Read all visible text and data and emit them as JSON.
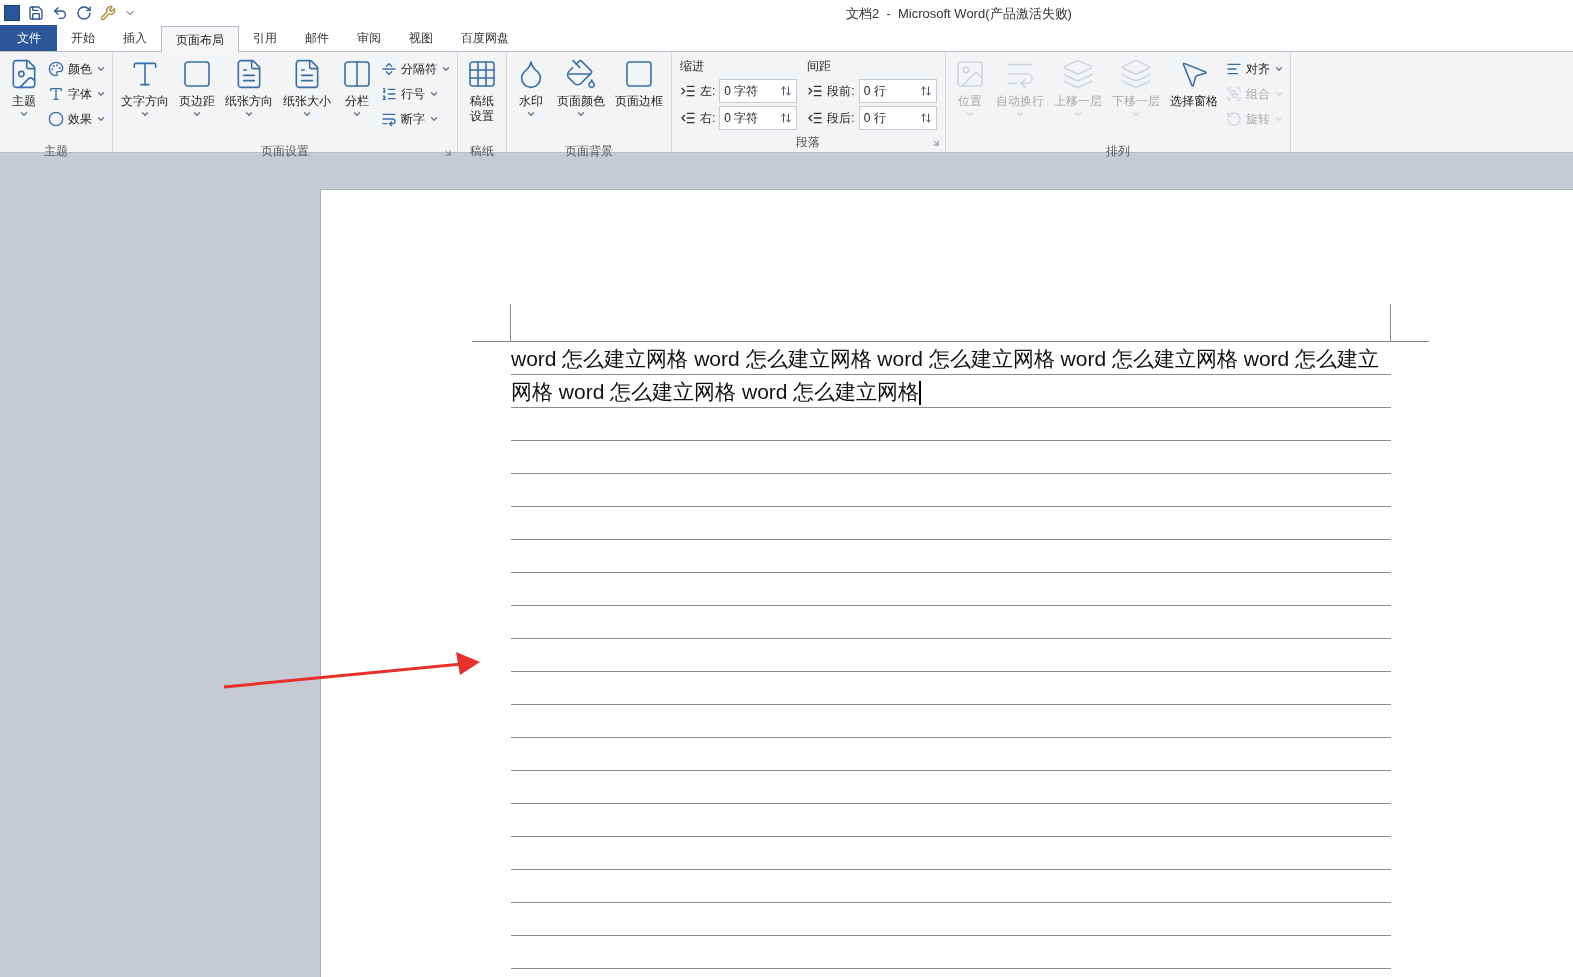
{
  "window": {
    "title": "文档2  -  Microsoft Word(产品激活失败)"
  },
  "tabs": [
    {
      "label": "文件",
      "kind": "file",
      "selected": false
    },
    {
      "label": "开始",
      "kind": "tab",
      "selected": false
    },
    {
      "label": "插入",
      "kind": "tab",
      "selected": false
    },
    {
      "label": "页面布局",
      "kind": "tab",
      "selected": true
    },
    {
      "label": "引用",
      "kind": "tab",
      "selected": false
    },
    {
      "label": "邮件",
      "kind": "tab",
      "selected": false
    },
    {
      "label": "审阅",
      "kind": "tab",
      "selected": false
    },
    {
      "label": "视图",
      "kind": "tab",
      "selected": false
    },
    {
      "label": "百度网盘",
      "kind": "tab",
      "selected": false
    }
  ],
  "ribbon": [
    {
      "name": "主题",
      "launcher": false,
      "columns": [
        {
          "kind": "large",
          "label": "主题",
          "dropdown": true,
          "disabled": false
        },
        {
          "kind": "stack",
          "items": [
            {
              "label": "颜色",
              "dropdown": true,
              "disabled": false
            },
            {
              "label": "字体",
              "dropdown": true,
              "disabled": false
            },
            {
              "label": "效果",
              "dropdown": true,
              "disabled": false
            }
          ]
        }
      ]
    },
    {
      "name": "页面设置",
      "launcher": true,
      "columns": [
        {
          "kind": "large",
          "label": "文字方向",
          "dropdown": true,
          "disabled": false
        },
        {
          "kind": "large",
          "label": "页边距",
          "dropdown": true,
          "disabled": false
        },
        {
          "kind": "large",
          "label": "纸张方向",
          "dropdown": true,
          "disabled": false
        },
        {
          "kind": "large",
          "label": "纸张大小",
          "dropdown": true,
          "disabled": false
        },
        {
          "kind": "large",
          "label": "分栏",
          "dropdown": true,
          "disabled": false
        },
        {
          "kind": "stack",
          "items": [
            {
              "label": "分隔符",
              "dropdown": true,
              "disabled": false
            },
            {
              "label": "行号",
              "dropdown": true,
              "disabled": false
            },
            {
              "label": "断字",
              "dropdown": true,
              "disabled": false
            }
          ]
        }
      ]
    },
    {
      "name": "稿纸",
      "launcher": false,
      "columns": [
        {
          "kind": "large",
          "label": "稿纸设置",
          "dropdown": false,
          "disabled": false
        }
      ]
    },
    {
      "name": "页面背景",
      "launcher": false,
      "columns": [
        {
          "kind": "large",
          "label": "水印",
          "dropdown": true,
          "disabled": false
        },
        {
          "kind": "large",
          "label": "页面颜色",
          "dropdown": true,
          "disabled": false
        },
        {
          "kind": "large",
          "label": "页面边框",
          "dropdown": false,
          "disabled": false
        }
      ]
    },
    {
      "name": "段落",
      "launcher": true,
      "columns": [
        {
          "kind": "spins",
          "heading": "缩进",
          "rows": [
            {
              "label": "左:",
              "value": "0 字符"
            },
            {
              "label": "右:",
              "value": "0 字符"
            }
          ]
        },
        {
          "kind": "spins",
          "heading": "间距",
          "rows": [
            {
              "label": "段前:",
              "value": "0 行"
            },
            {
              "label": "段后:",
              "value": "0 行"
            }
          ]
        }
      ]
    },
    {
      "name": "排列",
      "launcher": false,
      "columns": [
        {
          "kind": "large",
          "label": "位置",
          "dropdown": true,
          "disabled": true
        },
        {
          "kind": "large",
          "label": "自动换行",
          "dropdown": true,
          "disabled": true
        },
        {
          "kind": "large",
          "label": "上移一层",
          "dropdown": true,
          "disabled": true
        },
        {
          "kind": "large",
          "label": "下移一层",
          "dropdown": true,
          "disabled": true
        },
        {
          "kind": "large",
          "label": "选择窗格",
          "dropdown": false,
          "disabled": false
        },
        {
          "kind": "stack",
          "items": [
            {
              "label": "对齐",
              "dropdown": true,
              "disabled": false
            },
            {
              "label": "组合",
              "dropdown": true,
              "disabled": true
            },
            {
              "label": "旋转",
              "dropdown": true,
              "disabled": true
            }
          ]
        }
      ]
    }
  ],
  "document": {
    "text": "word 怎么建立网格 word 怎么建立网格 word 怎么建立网格 word 怎么建立网格 word 怎么建立网格 word 怎么建立网格 word 怎么建立网格",
    "cursor": true
  }
}
